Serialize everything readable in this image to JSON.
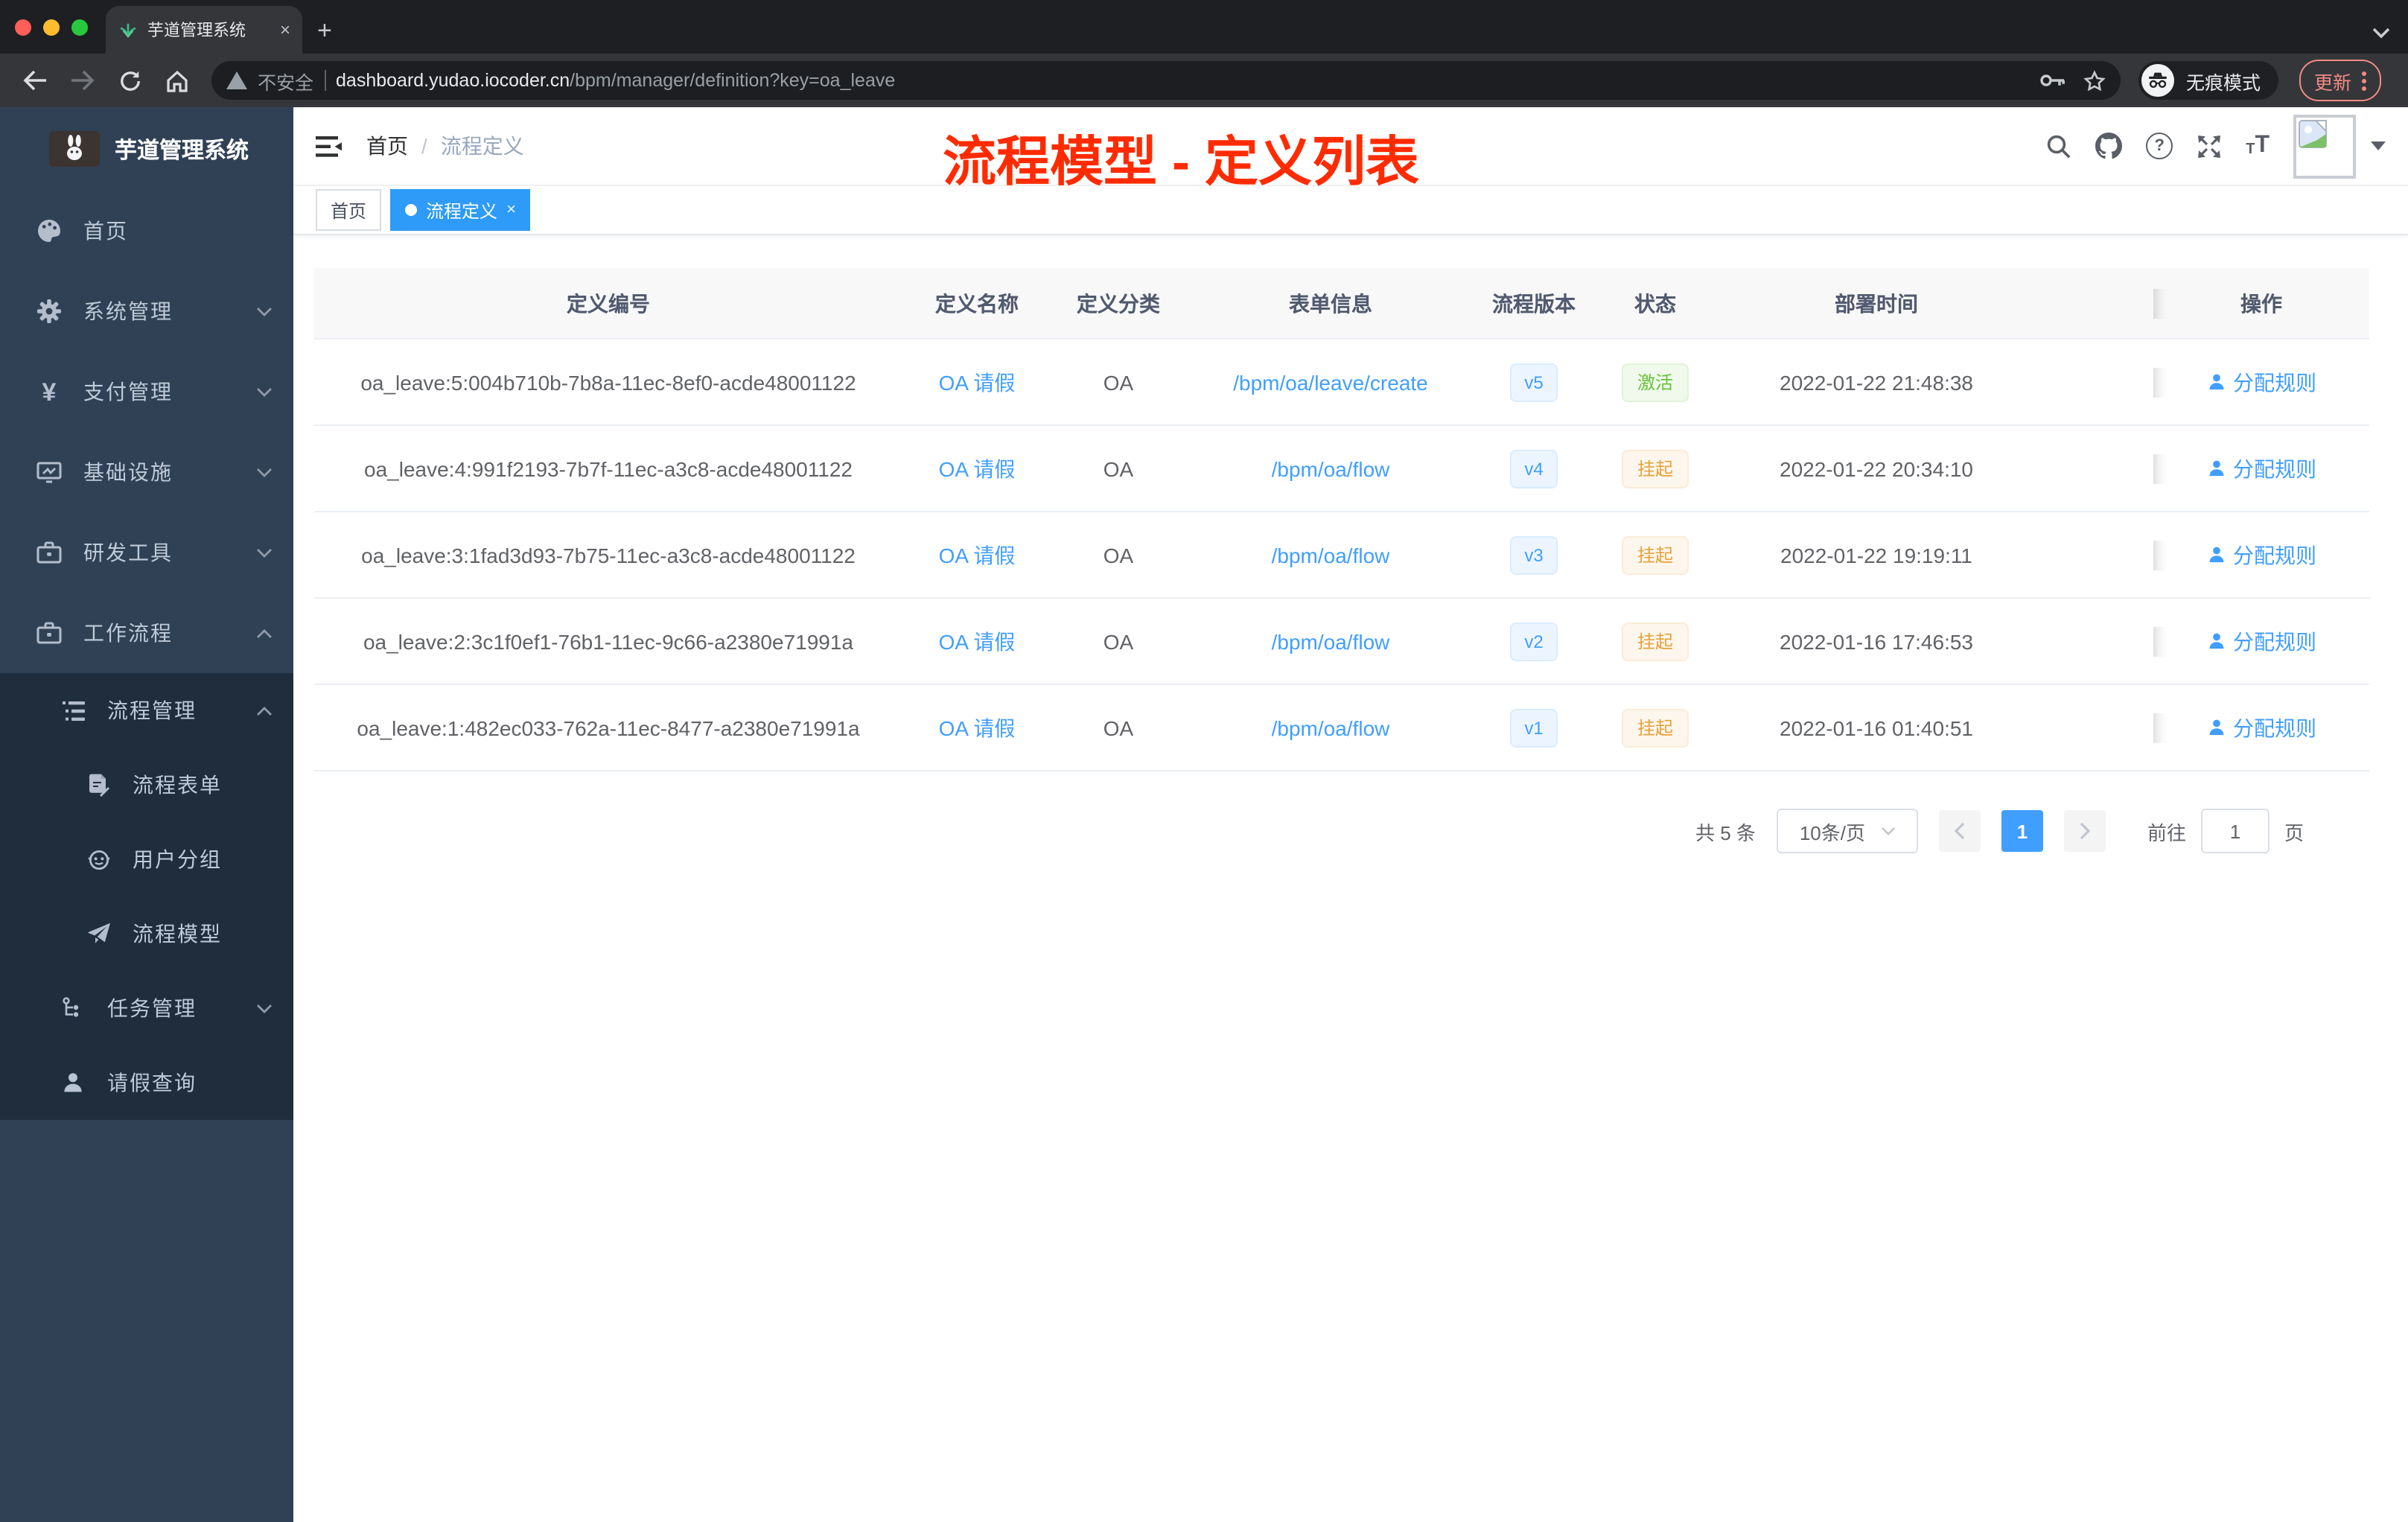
{
  "browser": {
    "tab_title": "芋道管理系统",
    "tab_close": "×",
    "new_tab": "+",
    "security_label": "不安全",
    "url_host": "dashboard.yudao.iocoder.cn",
    "url_path": "/bpm/manager/definition?key=oa_leave",
    "incognito_label": "无痕模式",
    "update_label": "更新"
  },
  "annotation": {
    "title": "流程模型 - 定义列表",
    "color": "#ff2b00"
  },
  "sidebar": {
    "app_title": "芋道管理系统",
    "menu": [
      {
        "label": "首页"
      },
      {
        "label": "系统管理"
      },
      {
        "label": "支付管理"
      },
      {
        "label": "基础设施"
      },
      {
        "label": "研发工具"
      },
      {
        "label": "工作流程"
      }
    ],
    "workflow": {
      "process_management": "流程管理",
      "children": [
        {
          "label": "流程表单"
        },
        {
          "label": "用户分组"
        },
        {
          "label": "流程模型"
        }
      ],
      "task_management": "任务管理",
      "leave_query": "请假查询"
    }
  },
  "navbar": {
    "breadcrumb_home": "首页",
    "breadcrumb_separator": "/",
    "breadcrumb_current": "流程定义"
  },
  "tags": {
    "home": "首页",
    "active": "流程定义",
    "close": "×"
  },
  "table": {
    "columns": [
      "定义编号",
      "定义名称",
      "定义分类",
      "表单信息",
      "流程版本",
      "状态",
      "部署时间",
      "操作"
    ],
    "rows": [
      {
        "id": "oa_leave:5:004b710b-7b8a-11ec-8ef0-acde48001122",
        "name": "OA 请假",
        "category": "OA",
        "form": "/bpm/oa/leave/create",
        "version": "v5",
        "status": "激活",
        "time": "2022-01-22 21:48:38",
        "action": "分配规则"
      },
      {
        "id": "oa_leave:4:991f2193-7b7f-11ec-a3c8-acde48001122",
        "name": "OA 请假",
        "category": "OA",
        "form": "/bpm/oa/flow",
        "version": "v4",
        "status": "挂起",
        "time": "2022-01-22 20:34:10",
        "action": "分配规则"
      },
      {
        "id": "oa_leave:3:1fad3d93-7b75-11ec-a3c8-acde48001122",
        "name": "OA 请假",
        "category": "OA",
        "form": "/bpm/oa/flow",
        "version": "v3",
        "status": "挂起",
        "time": "2022-01-22 19:19:11",
        "action": "分配规则"
      },
      {
        "id": "oa_leave:2:3c1f0ef1-76b1-11ec-9c66-a2380e71991a",
        "name": "OA 请假",
        "category": "OA",
        "form": "/bpm/oa/flow",
        "version": "v2",
        "status": "挂起",
        "time": "2022-01-16 17:46:53",
        "action": "分配规则"
      },
      {
        "id": "oa_leave:1:482ec033-762a-11ec-8477-a2380e71991a",
        "name": "OA 请假",
        "category": "OA",
        "form": "/bpm/oa/flow",
        "version": "v1",
        "status": "挂起",
        "time": "2022-01-16 01:40:51",
        "action": "分配规则"
      }
    ]
  },
  "pagination": {
    "total": "共 5 条",
    "page_size": "10条/页",
    "page": "1",
    "goto_label": "前往",
    "goto_value": "1",
    "page_label": "页"
  },
  "colors": {
    "accent": "#409eff",
    "annotation_red": "#ff2b00",
    "sidebar_bg": "#304156",
    "submenu_bg": "#1f2d3d",
    "status_active": "#67c23a",
    "status_suspended": "#e6a23c"
  }
}
